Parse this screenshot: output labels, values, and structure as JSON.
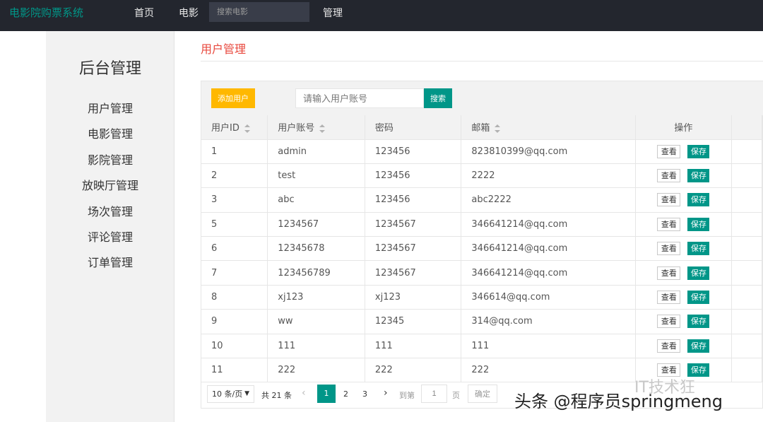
{
  "header": {
    "brand": "电影院购票系统",
    "nav": [
      {
        "label": "首页"
      },
      {
        "label": "电影"
      },
      {
        "label": "管理"
      }
    ],
    "search_placeholder": "搜索电影"
  },
  "sidebar": {
    "title": "后台管理",
    "items": [
      {
        "label": "用户管理"
      },
      {
        "label": "电影管理"
      },
      {
        "label": "影院管理"
      },
      {
        "label": "放映厅管理"
      },
      {
        "label": "场次管理"
      },
      {
        "label": "评论管理"
      },
      {
        "label": "订单管理"
      }
    ]
  },
  "main": {
    "title": "用户管理",
    "toolbar": {
      "add_label": "添加用户",
      "search_placeholder": "请输入用户账号",
      "search_label": "搜索"
    },
    "table": {
      "columns": [
        "用户ID",
        "用户账号",
        "密码",
        "邮箱",
        "操作"
      ],
      "view_label": "查看",
      "save_label": "保存",
      "rows": [
        {
          "id": "1",
          "account": "admin",
          "password": "123456",
          "email": "823810399@qq.com"
        },
        {
          "id": "2",
          "account": "test",
          "password": "123456",
          "email": "2222"
        },
        {
          "id": "3",
          "account": "abc",
          "password": "123456",
          "email": "abc2222"
        },
        {
          "id": "5",
          "account": "1234567",
          "password": "1234567",
          "email": "346641214@qq.com"
        },
        {
          "id": "6",
          "account": "12345678",
          "password": "1234567",
          "email": "346641214@qq.com"
        },
        {
          "id": "7",
          "account": "123456789",
          "password": "1234567",
          "email": "346641214@qq.com"
        },
        {
          "id": "8",
          "account": "xj123",
          "password": "xj123",
          "email": "346614@qq.com"
        },
        {
          "id": "9",
          "account": "ww",
          "password": "12345",
          "email": "314@qq.com"
        },
        {
          "id": "10",
          "account": "111",
          "password": "111",
          "email": "111"
        },
        {
          "id": "11",
          "account": "222",
          "password": "222",
          "email": "222"
        }
      ]
    },
    "pager": {
      "page_size": "10 条/页",
      "total": "共 21 条",
      "pages": [
        "1",
        "2",
        "3"
      ],
      "current_page": "1",
      "goto_label": "到第",
      "page_unit": "页",
      "goto_value": "1",
      "confirm_label": "确定"
    }
  },
  "watermark": {
    "text": "头条 @程序员springmeng",
    "logo_text": "IT技术狂"
  }
}
